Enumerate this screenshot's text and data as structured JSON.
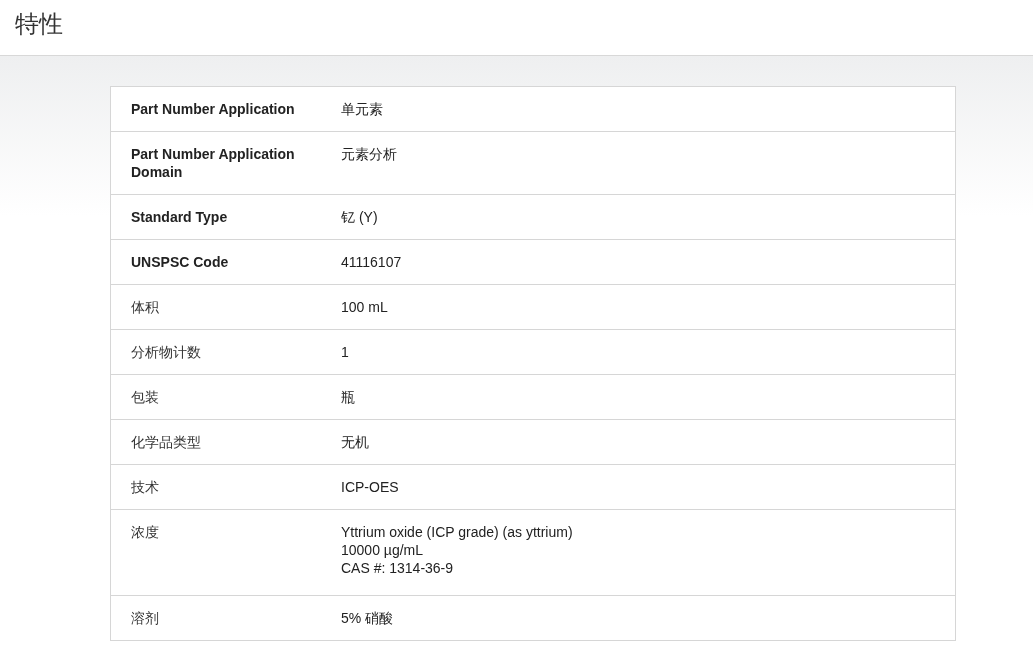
{
  "header": {
    "title": "特性"
  },
  "rows": [
    {
      "label": "Part Number Application",
      "bold": true,
      "lines": [
        "单元素"
      ]
    },
    {
      "label": "Part Number Application Domain",
      "bold": true,
      "lines": [
        "元素分析"
      ]
    },
    {
      "label": "Standard Type",
      "bold": true,
      "lines": [
        "钇 (Y)"
      ]
    },
    {
      "label": "UNSPSC Code",
      "bold": true,
      "lines": [
        "41116107"
      ]
    },
    {
      "label": "体积",
      "bold": false,
      "lines": [
        "100 mL"
      ]
    },
    {
      "label": "分析物计数",
      "bold": false,
      "lines": [
        "1"
      ]
    },
    {
      "label": "包装",
      "bold": false,
      "lines": [
        "瓶"
      ]
    },
    {
      "label": "化学品类型",
      "bold": false,
      "lines": [
        "无机"
      ]
    },
    {
      "label": "技术",
      "bold": false,
      "lines": [
        "ICP-OES"
      ]
    },
    {
      "label": "浓度",
      "bold": false,
      "lines": [
        "Yttrium oxide (ICP grade) (as yttrium)",
        "10000 µg/mL",
        "CAS #: 1314-36-9"
      ]
    },
    {
      "label": "溶剂",
      "bold": false,
      "lines": [
        "5% 硝酸"
      ]
    }
  ]
}
